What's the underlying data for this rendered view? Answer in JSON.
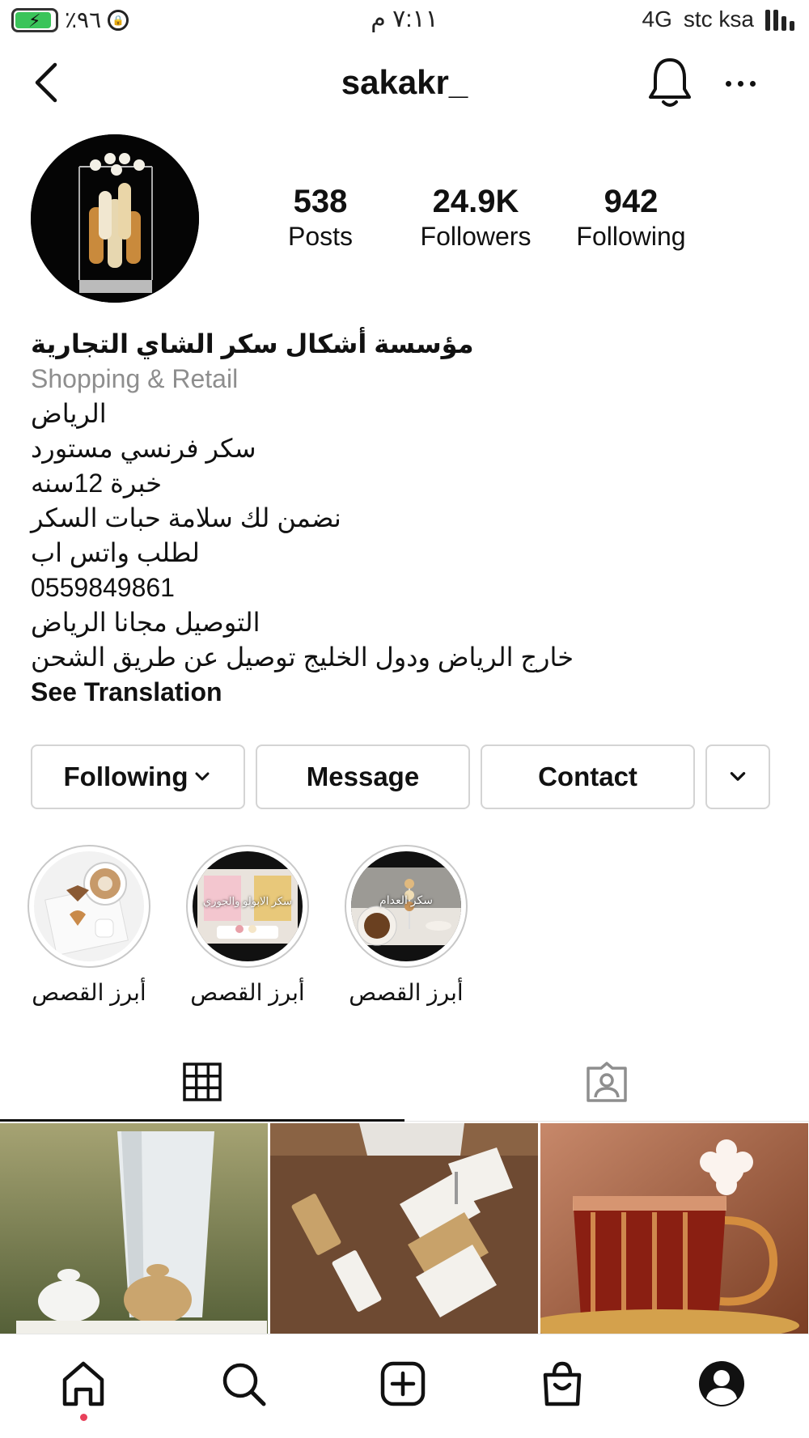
{
  "status_bar": {
    "battery": "٪٩٦",
    "time": "٧:١١ م",
    "network": "4G",
    "carrier": "stc ksa"
  },
  "header": {
    "username": "sakakr_"
  },
  "stats": [
    {
      "value": "538",
      "label": "Posts"
    },
    {
      "value": "24.9K",
      "label": "Followers"
    },
    {
      "value": "942",
      "label": "Following"
    }
  ],
  "bio": {
    "name": "مؤسسة أشكال سكر الشاي التجارية",
    "category": "Shopping & Retail",
    "lines": [
      "الرياض",
      "سكر فرنسي مستورد",
      "خبرة 12سنه",
      "نضمن لك سلامة حبات السكر",
      "لطلب واتس اب",
      "0559849861",
      "التوصيل مجانا الرياض",
      "خارج الرياض ودول الخليج توصيل عن طريق الشحن"
    ],
    "see_translation": "See Translation"
  },
  "buttons": {
    "following": "Following",
    "message": "Message",
    "contact": "Contact"
  },
  "highlights": [
    {
      "label": "أبرز القصص",
      "caption": ""
    },
    {
      "label": "أبرز القصص",
      "caption": "سكر الابولو والجوري"
    },
    {
      "label": "أبرز القصص",
      "caption": "سكر العدام"
    }
  ],
  "colors": {
    "accent_dot": "#e8405a",
    "muted_text": "#8e8e8e",
    "border": "#d4d4d4"
  },
  "icons": {
    "back": "chevron-left-icon",
    "bell": "bell-icon",
    "more": "more-horizontal-icon",
    "grid": "grid-icon",
    "tagged": "tagged-person-icon",
    "home": "home-icon",
    "search": "search-icon",
    "create": "plus-square-icon",
    "shop": "shopping-bag-icon",
    "profile": "profile-icon"
  }
}
